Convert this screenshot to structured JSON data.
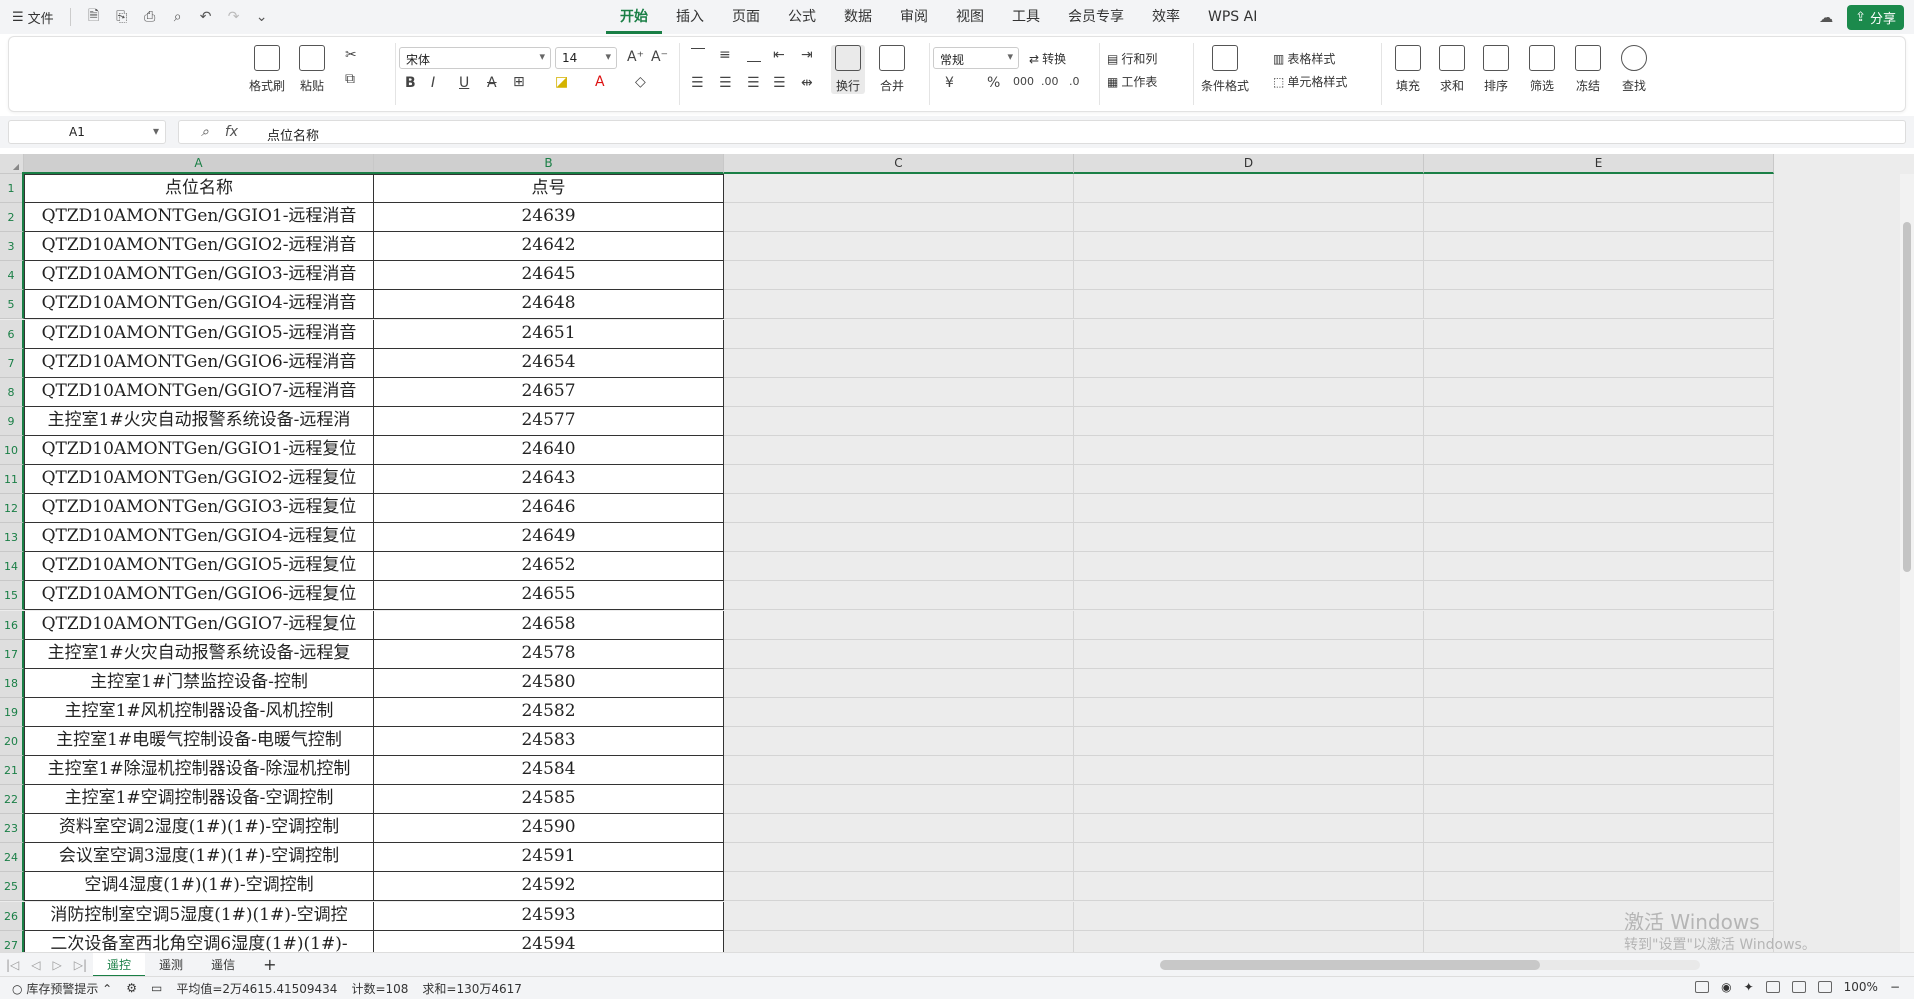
{
  "menu": {
    "file_label": "文件",
    "tabs": [
      "开始",
      "插入",
      "页面",
      "公式",
      "数据",
      "审阅",
      "视图",
      "工具",
      "会员专享",
      "效率",
      "WPS AI"
    ],
    "active_tab": "开始",
    "share_label": "分享"
  },
  "ribbon": {
    "format_painter": "格式刷",
    "paste": "粘贴",
    "font_name": "宋体",
    "font_size": "14",
    "wrap": "换行",
    "merge": "合并",
    "number_format": "常规",
    "convert": "转换",
    "row_col": "行和列",
    "worksheet": "工作表",
    "conditional": "条件格式",
    "table_style": "表格样式",
    "cell_style": "单元格样式",
    "fill": "填充",
    "sum": "求和",
    "sort": "排序",
    "filter": "筛选",
    "freeze": "冻结",
    "find": "查找"
  },
  "formula": {
    "name_box": "A1",
    "content": "点位名称"
  },
  "columns": [
    "A",
    "B",
    "C",
    "D",
    "E"
  ],
  "table": {
    "headers": [
      "点位名称",
      "点号"
    ],
    "rows": [
      [
        "QTZD10AMONTGen/GGIO1-远程消音",
        "24639"
      ],
      [
        "QTZD10AMONTGen/GGIO2-远程消音",
        "24642"
      ],
      [
        "QTZD10AMONTGen/GGIO3-远程消音",
        "24645"
      ],
      [
        "QTZD10AMONTGen/GGIO4-远程消音",
        "24648"
      ],
      [
        "QTZD10AMONTGen/GGIO5-远程消音",
        "24651"
      ],
      [
        "QTZD10AMONTGen/GGIO6-远程消音",
        "24654"
      ],
      [
        "QTZD10AMONTGen/GGIO7-远程消音",
        "24657"
      ],
      [
        "主控室1#火灾自动报警系统设备-远程消",
        "24577"
      ],
      [
        "QTZD10AMONTGen/GGIO1-远程复位",
        "24640"
      ],
      [
        "QTZD10AMONTGen/GGIO2-远程复位",
        "24643"
      ],
      [
        "QTZD10AMONTGen/GGIO3-远程复位",
        "24646"
      ],
      [
        "QTZD10AMONTGen/GGIO4-远程复位",
        "24649"
      ],
      [
        "QTZD10AMONTGen/GGIO5-远程复位",
        "24652"
      ],
      [
        "QTZD10AMONTGen/GGIO6-远程复位",
        "24655"
      ],
      [
        "QTZD10AMONTGen/GGIO7-远程复位",
        "24658"
      ],
      [
        "主控室1#火灾自动报警系统设备-远程复",
        "24578"
      ],
      [
        "主控室1#门禁监控设备-控制",
        "24580"
      ],
      [
        "主控室1#风机控制器设备-风机控制",
        "24582"
      ],
      [
        "主控室1#电暖气控制设备-电暖气控制",
        "24583"
      ],
      [
        "主控室1#除湿机控制器设备-除湿机控制",
        "24584"
      ],
      [
        "主控室1#空调控制器设备-空调控制",
        "24585"
      ],
      [
        "资料室空调2湿度(1#)(1#)-空调控制",
        "24590"
      ],
      [
        "会议室空调3湿度(1#)(1#)-空调控制",
        "24591"
      ],
      [
        "空调4湿度(1#)(1#)-空调控制",
        "24592"
      ],
      [
        "消防控制室空调5湿度(1#)(1#)-空调控",
        "24593"
      ],
      [
        "二次设备室西北角空调6湿度(1#)(1#)-",
        "24594"
      ]
    ]
  },
  "sheets": [
    "遥控",
    "遥测",
    "遥信"
  ],
  "active_sheet": "遥控",
  "watermark": {
    "line1": "激活 Windows",
    "line2": "转到\"设置\"以激活 Windows。"
  },
  "status": {
    "alert": "库存预警提示",
    "average": "平均值=2万4615.41509434",
    "count": "计数=108",
    "sum": "求和=130万4617",
    "zoom": "100%"
  }
}
